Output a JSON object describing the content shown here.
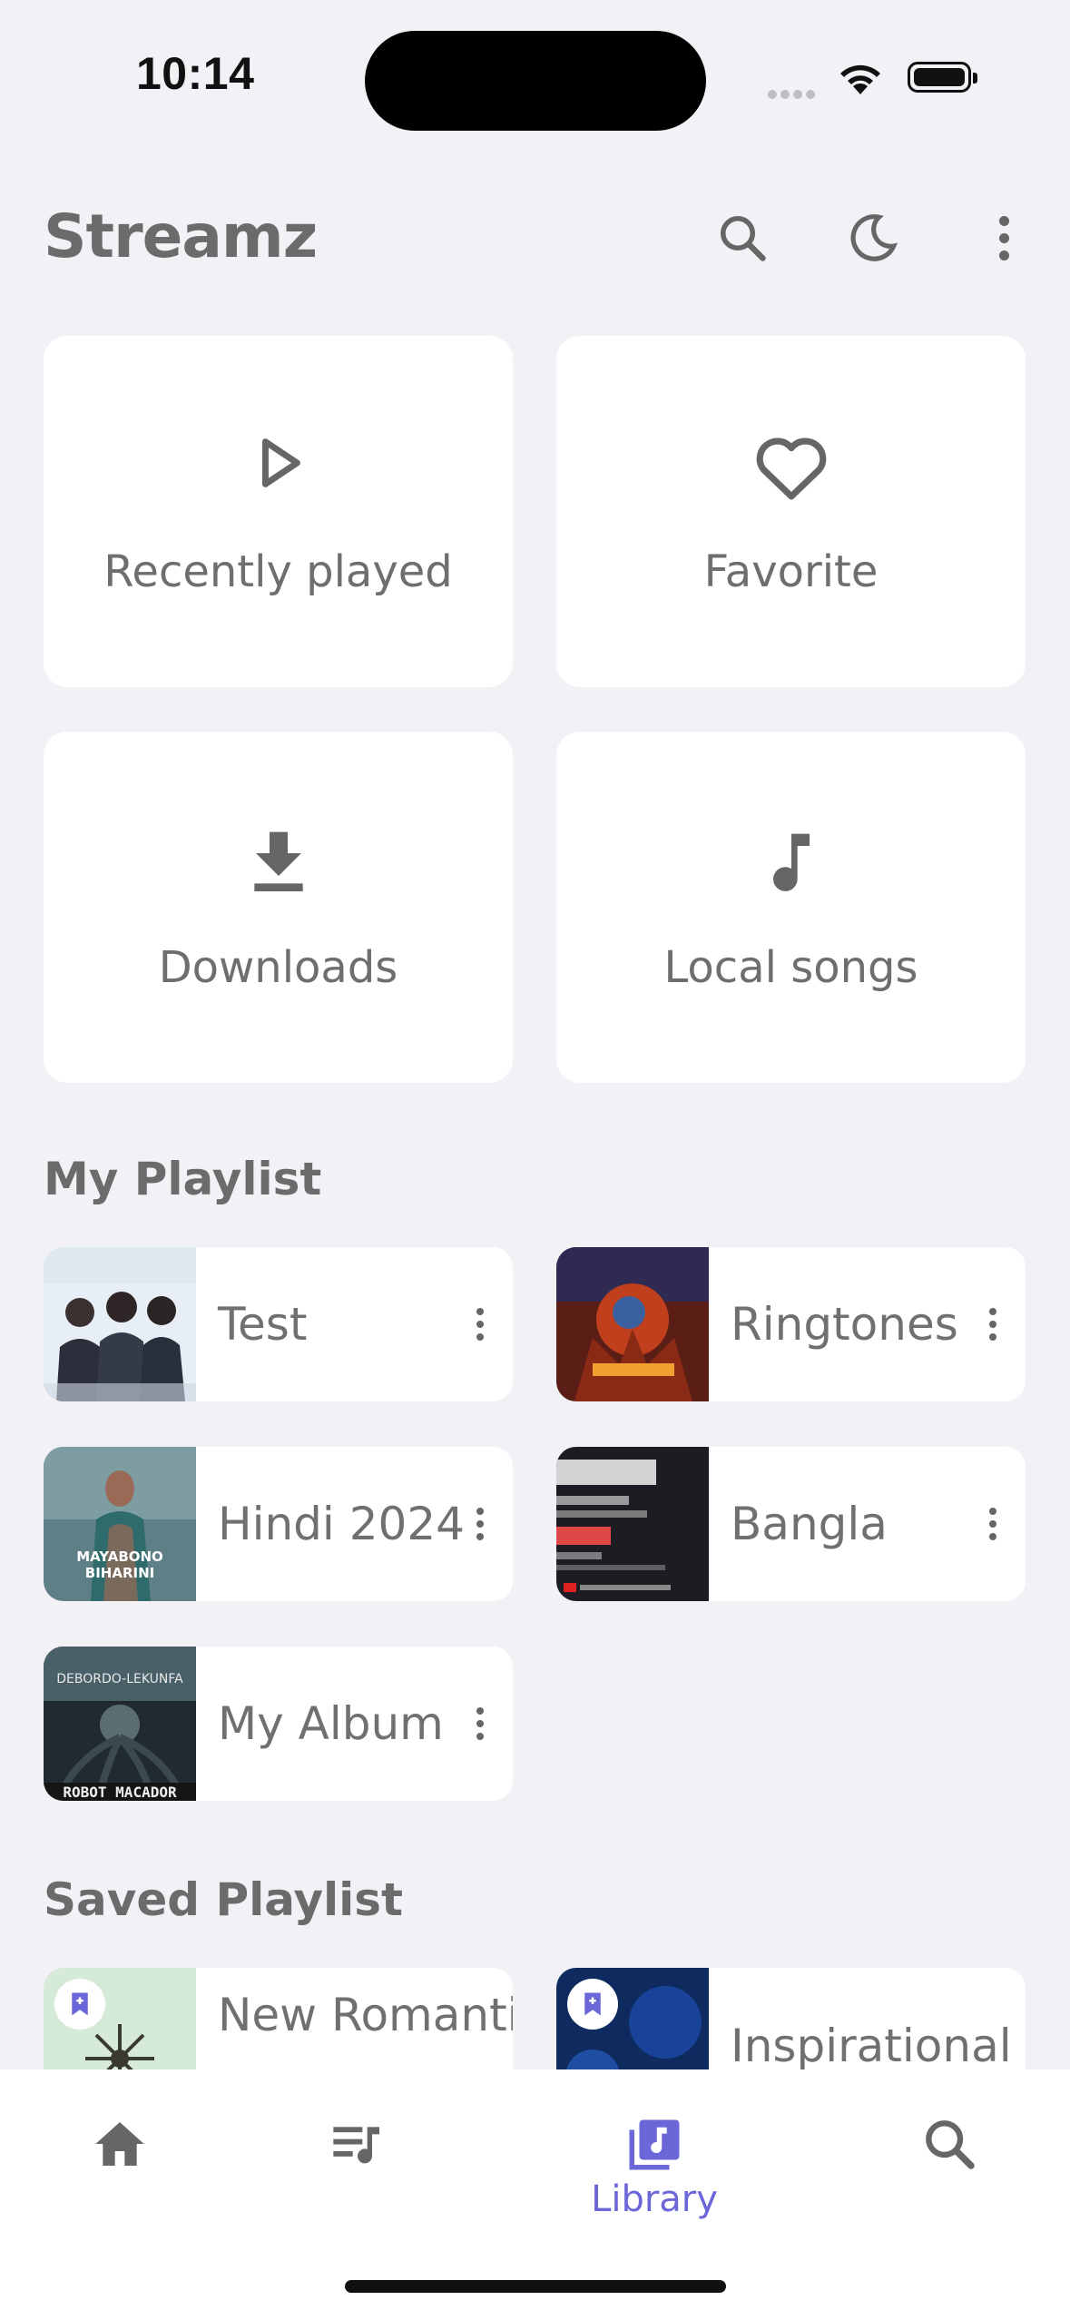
{
  "status_bar": {
    "time": "10:14"
  },
  "app": {
    "title": "Streamz"
  },
  "quick_access": [
    {
      "label": "Recently played",
      "icon": "play-outline-icon"
    },
    {
      "label": "Favorite",
      "icon": "heart-outline-icon"
    },
    {
      "label": "Downloads",
      "icon": "download-icon"
    },
    {
      "label": "Local songs",
      "icon": "music-note-icon"
    }
  ],
  "my_playlist": {
    "title": "My Playlist",
    "items": [
      {
        "name": "Test"
      },
      {
        "name": "Ringtones"
      },
      {
        "name": "Hindi 2024",
        "cover_text": [
          "MAYABONO",
          "BIHARINI"
        ]
      },
      {
        "name": "Bangla"
      },
      {
        "name": "My Album",
        "cover_text": [
          "DEBORDO-LEKUNFA",
          "ROBOT MACADOR"
        ]
      }
    ]
  },
  "saved_playlist": {
    "title": "Saved Playlist",
    "items": [
      {
        "name": "New Romantic"
      },
      {
        "name": "Inspirational"
      }
    ]
  },
  "bottom_nav": {
    "items": [
      {
        "label": "",
        "icon": "home-icon"
      },
      {
        "label": "",
        "icon": "queue-music-icon"
      },
      {
        "label": "Library",
        "icon": "library-music-icon",
        "active": true
      },
      {
        "label": "",
        "icon": "search-icon"
      }
    ]
  },
  "colors": {
    "background": "#f2f1f6",
    "accent": "#6b67d8",
    "card": "#ffffff",
    "text": "#6e6e6e"
  }
}
